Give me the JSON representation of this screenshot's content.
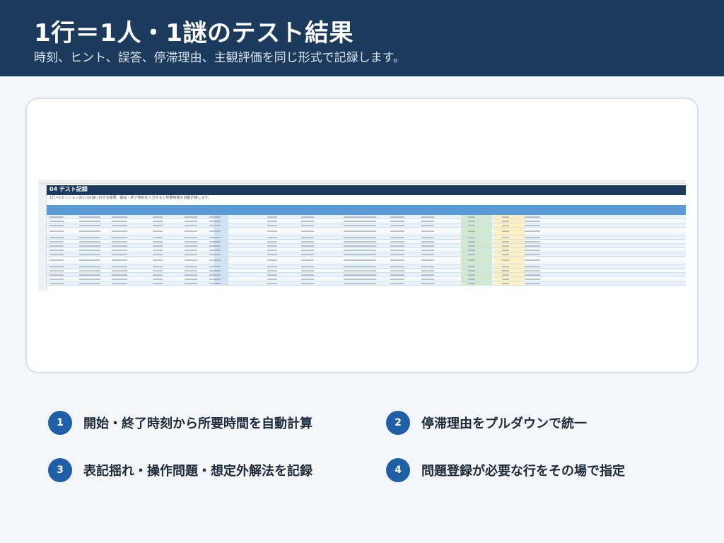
{
  "slide": {
    "title": "1行＝1人・1謎のテスト結果",
    "subtitle": "時刻、ヒント、誤答、停滞理由、主観評価を同じ形式で記録します。"
  },
  "spreadsheet": {
    "title": "04 テスト記録",
    "description": "1行＝1セッションの1つの謎に対する結果。開始・終了時刻を入力すると所要時間を自動計算します。"
  },
  "features": [
    {
      "number": "1",
      "label": "開始・終了時刻から所要時間を自動計算"
    },
    {
      "number": "2",
      "label": "停滞理由をプルダウンで統一"
    },
    {
      "number": "3",
      "label": "表記揺れ・操作問題・想定外解法を記録"
    },
    {
      "number": "4",
      "label": "問題登録が必要な行をその場で指定"
    }
  ],
  "colors": {
    "header_bg": "#1b3a5c",
    "badge": "#1f5fa5",
    "table_head": "#5b9bd5"
  }
}
